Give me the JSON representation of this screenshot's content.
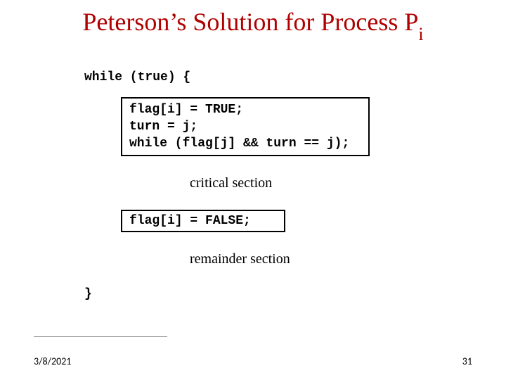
{
  "title": {
    "main": "Peterson’s Solution for Process P",
    "sub": "i"
  },
  "code": {
    "while_open": "while (true) {",
    "box1_line1": "flag[i] = TRUE;",
    "box1_line2": "turn = j;",
    "box1_line3": "while (flag[j] && turn == j);",
    "critical": "critical section",
    "box2_line1": "flag[i] = FALSE;",
    "remainder": "remainder section",
    "close": "}"
  },
  "footer": {
    "date": "3/8/2021",
    "page": "31"
  }
}
